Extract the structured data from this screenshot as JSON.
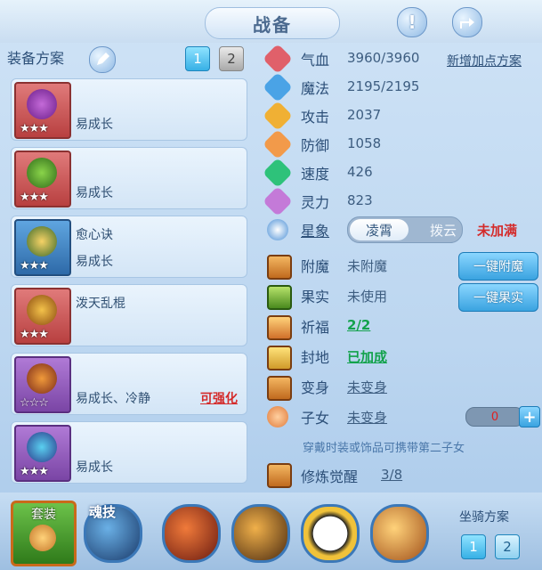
{
  "header": {
    "title": "战备",
    "help_icon": "help-icon",
    "share_icon": "share-icon"
  },
  "equip": {
    "heading": "装备方案",
    "tabs": [
      "1",
      "2"
    ],
    "items": [
      {
        "line1": "",
        "line2": "易成长",
        "badge": "",
        "stars": "★★★"
      },
      {
        "line1": "",
        "line2": "易成长",
        "badge": "",
        "stars": "★★★"
      },
      {
        "line1": "愈心诀",
        "line2": "易成长",
        "badge": "",
        "stars": "★★★"
      },
      {
        "line1": "泼天乱棍",
        "line2": "",
        "badge": "",
        "stars": "★★★"
      },
      {
        "line1": "",
        "line2": "易成长、冷静",
        "badge": "可强化",
        "stars": "☆☆☆"
      },
      {
        "line1": "",
        "line2": "易成长",
        "badge": "",
        "stars": "★★★"
      }
    ]
  },
  "stats": [
    {
      "label": "气血",
      "value": "3960/3960",
      "color": "#e0606a"
    },
    {
      "label": "魔法",
      "value": "2195/2195",
      "color": "#4aa3e6"
    },
    {
      "label": "攻击",
      "value": "2037",
      "color": "#f0b034"
    },
    {
      "label": "防御",
      "value": "1058",
      "color": "#f29a4a"
    },
    {
      "label": "速度",
      "value": "426",
      "color": "#2ec27a"
    },
    {
      "label": "灵力",
      "value": "823",
      "color": "#c47ad8"
    }
  ],
  "add_points_link": "新增加点方案",
  "xingxiang": {
    "label": "星象",
    "option_on": "凌霄",
    "option_off": "拨云",
    "status": "未加满"
  },
  "extras": [
    {
      "label": "附魔",
      "value": "未附魔",
      "style": "normal"
    },
    {
      "label": "果实",
      "value": "未使用",
      "style": "normal"
    },
    {
      "label": "祈福",
      "value": "2/2",
      "style": "green"
    },
    {
      "label": "封地",
      "value": "已加成",
      "style": "green"
    },
    {
      "label": "变身",
      "value": "未变身",
      "style": "underline"
    },
    {
      "label": "子女",
      "value": "未变身",
      "style": "underline"
    }
  ],
  "buttons": {
    "enchant": "一键附魔",
    "fruit": "一键果实"
  },
  "child_hint": "穿戴时装或饰品可携带第二子女",
  "child_count": "0",
  "cultivation": {
    "label": "修炼觉醒",
    "value": "3/8"
  },
  "bottom": {
    "suit_label": "套装",
    "soul_label": "魂技",
    "mount_label": "坐骑方案",
    "mount_tabs": [
      "1",
      "2"
    ]
  }
}
